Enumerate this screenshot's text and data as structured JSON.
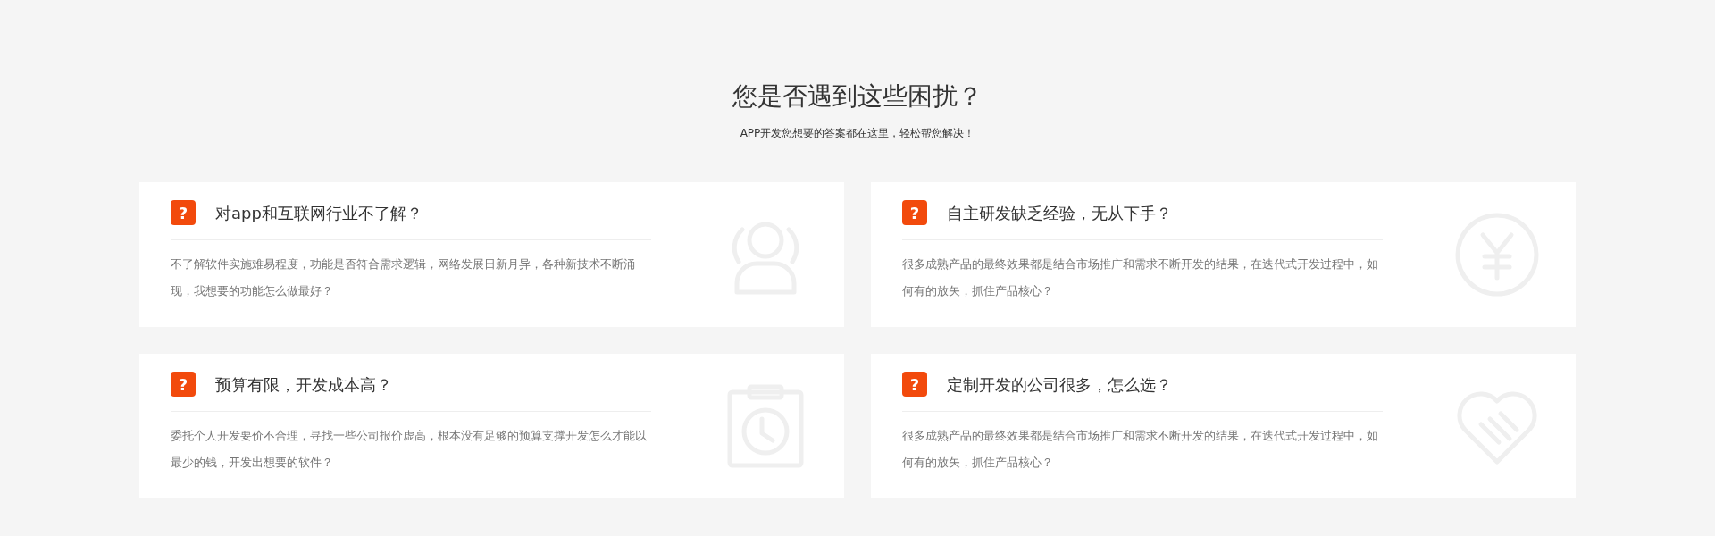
{
  "heading": {
    "title": "您是否遇到这些困扰？",
    "subtitle": "APP开发您想要的答案都在这里，轻松帮您解决！"
  },
  "cards": [
    {
      "badge": "?",
      "title": "对app和互联网行业不了解？",
      "description": "不了解软件实施难易程度，功能是否符合需求逻辑，网络发展日新月异，各种新技术不断涌现，我想要的功能怎么做最好？",
      "kind": "person"
    },
    {
      "badge": "?",
      "title": "自主研发缺乏经验，无从下手？",
      "description": "很多成熟产品的最终效果都是结合市场推广和需求不断开发的结果，在迭代式开发过程中，如何有的放矢，抓住产品核心？",
      "kind": "yen"
    },
    {
      "badge": "?",
      "title": "预算有限，开发成本高？",
      "description": "委托个人开发要价不合理，寻找一些公司报价虚高，根本没有足够的预算支撑开发怎么才能以最少的钱，开发出想要的软件？",
      "kind": "clock"
    },
    {
      "badge": "?",
      "title": "定制开发的公司很多，怎么选？",
      "description": "很多成熟产品的最终效果都是结合市场推广和需求不断开发的结果，在迭代式开发过程中，如何有的放矢，抓住产品核心？",
      "kind": "heart"
    }
  ]
}
